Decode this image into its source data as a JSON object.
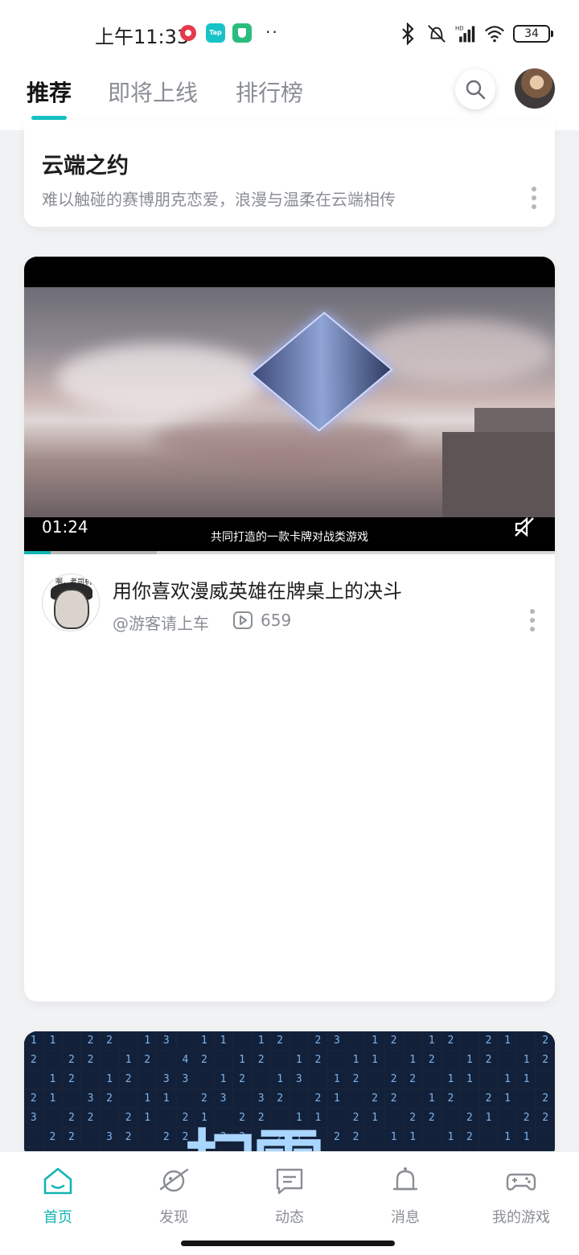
{
  "status_bar": {
    "time": "上午11:33",
    "app_badge_tap": "Tap",
    "more": "··",
    "battery": "34",
    "icons": [
      "red-app-icon",
      "tap-app-icon",
      "shield-app-icon",
      "bluetooth-icon",
      "mute-vibrate-icon",
      "hd-signal-icon",
      "wifi-icon",
      "battery-icon"
    ]
  },
  "top_nav": {
    "tabs": [
      {
        "label": "推荐",
        "active": true
      },
      {
        "label": "即将上线",
        "active": false
      },
      {
        "label": "排行榜",
        "active": false
      }
    ],
    "accent_color": "#14c2c2"
  },
  "cards": {
    "game_intro": {
      "title": "云端之约",
      "subtitle": "难以触碰的赛博朋克恋爱，浪漫与温柔在云端相传"
    },
    "video_post": {
      "duration": "01:24",
      "video_caption": "共同打造的一款卡牌对战类游戏",
      "progress_fraction": 0.05,
      "buffered_fraction": 0.25,
      "title": "用你喜欢漫威英雄在牌桌上的决斗",
      "author": "@游客请上车",
      "play_count": "659",
      "author_avatar_caption": "啊，老司机"
    },
    "next_post": {
      "grid_numbers": [
        "1",
        "1",
        "1",
        "2",
        "2",
        "1",
        "1",
        "3",
        "2",
        "1",
        "1",
        "1",
        "1",
        "2",
        "3",
        "2",
        "3",
        "2",
        "1",
        "2",
        "1",
        "1",
        "2",
        "2",
        "2",
        "1",
        "2",
        "2",
        "2",
        "1",
        "2",
        "2",
        "3",
        "1",
        "2",
        "2",
        "4",
        "2",
        "1",
        "1",
        "2",
        "1",
        "1",
        "2",
        "2",
        "1",
        "1",
        "1",
        "1",
        "2",
        "1",
        "1",
        "2",
        "2",
        "1",
        "2",
        "1",
        "1",
        "2",
        "2",
        "1",
        "2",
        "2",
        "3",
        "3",
        "2",
        "1",
        "2",
        "2",
        "1",
        "3",
        "3",
        "1",
        "2",
        "1",
        "2",
        "2",
        "2",
        "1",
        "1"
      ],
      "overlay_text": "扫雷"
    }
  },
  "bottom_nav": [
    {
      "label": "首页",
      "icon": "home-icon",
      "active": true
    },
    {
      "label": "发现",
      "icon": "planet-icon",
      "active": false
    },
    {
      "label": "动态",
      "icon": "chat-icon",
      "active": false
    },
    {
      "label": "消息",
      "icon": "bell-icon",
      "active": false
    },
    {
      "label": "我的游戏",
      "icon": "gamepad-icon",
      "active": false
    }
  ]
}
